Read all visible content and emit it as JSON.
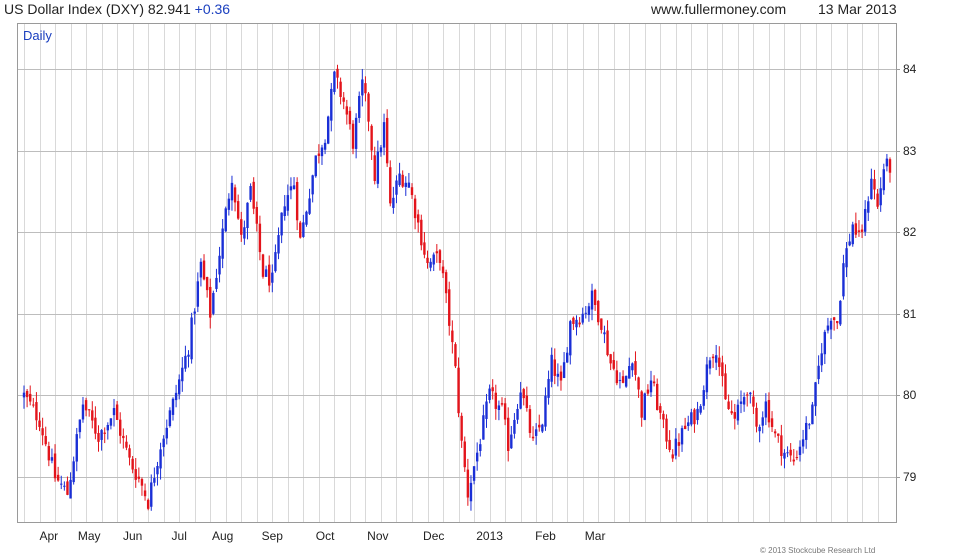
{
  "header": {
    "title": "US Dollar Index (DXY) 82.941",
    "change": "+0.36",
    "site": "www.fullermoney.com",
    "date": "13 Mar 2013"
  },
  "footer": {
    "copyright": "© 2013 Stockcube Research Ltd"
  },
  "colors": {
    "up": "#1a2fd6",
    "down": "#e3141b",
    "grid": "#d9d9d9",
    "frame": "#9a9a9a"
  },
  "chart_data": {
    "type": "candlestick",
    "period_label": "Daily",
    "title": "US Dollar Index (DXY) 82.941 +0.36",
    "y_ticks": [
      79,
      80,
      81,
      82,
      83,
      84
    ],
    "ylim": [
      78.45,
      84.55
    ],
    "x_tick_labels": [
      "Apr",
      "May",
      "Jun",
      "Jul",
      "Aug",
      "Sep",
      "Oct",
      "Nov",
      "Dec",
      "2013",
      "Feb",
      "Mar"
    ],
    "grid": true,
    "close_path": [
      [
        0,
        80.0
      ],
      [
        5,
        79.7
      ],
      [
        10,
        79.0
      ],
      [
        14,
        78.8
      ],
      [
        19,
        79.9
      ],
      [
        24,
        79.5
      ],
      [
        29,
        79.8
      ],
      [
        34,
        79.2
      ],
      [
        38,
        78.9
      ],
      [
        40,
        78.7
      ],
      [
        44,
        79.4
      ],
      [
        48,
        79.9
      ],
      [
        53,
        80.6
      ],
      [
        57,
        81.6
      ],
      [
        60,
        81.0
      ],
      [
        64,
        82.0
      ],
      [
        67,
        82.7
      ],
      [
        70,
        81.9
      ],
      [
        73,
        82.5
      ],
      [
        77,
        81.5
      ],
      [
        80,
        81.4
      ],
      [
        84,
        82.4
      ],
      [
        87,
        82.6
      ],
      [
        89,
        81.9
      ],
      [
        94,
        82.9
      ],
      [
        97,
        83.2
      ],
      [
        100,
        83.9
      ],
      [
        103,
        83.6
      ],
      [
        106,
        83.1
      ],
      [
        109,
        83.8
      ],
      [
        111,
        83.4
      ],
      [
        113,
        82.7
      ],
      [
        116,
        83.3
      ],
      [
        118,
        82.3
      ],
      [
        121,
        82.7
      ],
      [
        124,
        82.6
      ],
      [
        127,
        82.1
      ],
      [
        130,
        81.6
      ],
      [
        134,
        81.7
      ],
      [
        137,
        80.9
      ],
      [
        139,
        80.3
      ],
      [
        141,
        79.4
      ],
      [
        143,
        78.8
      ],
      [
        146,
        79.3
      ],
      [
        150,
        80.0
      ],
      [
        154,
        79.8
      ],
      [
        156,
        79.4
      ],
      [
        160,
        80.1
      ],
      [
        164,
        79.4
      ],
      [
        167,
        79.7
      ],
      [
        170,
        80.4
      ],
      [
        173,
        80.1
      ],
      [
        176,
        80.9
      ],
      [
        180,
        81.0
      ],
      [
        183,
        81.2
      ],
      [
        186,
        80.9
      ],
      [
        189,
        80.4
      ],
      [
        193,
        80.1
      ],
      [
        196,
        80.5
      ],
      [
        199,
        79.8
      ],
      [
        202,
        80.2
      ],
      [
        206,
        79.6
      ],
      [
        209,
        79.3
      ],
      [
        213,
        79.6
      ],
      [
        217,
        79.8
      ],
      [
        221,
        80.5
      ],
      [
        223,
        80.6
      ],
      [
        226,
        79.9
      ],
      [
        229,
        79.7
      ],
      [
        233,
        80.1
      ],
      [
        236,
        79.6
      ],
      [
        239,
        79.9
      ],
      [
        242,
        79.5
      ],
      [
        245,
        79.3
      ],
      [
        248,
        79.2
      ],
      [
        251,
        79.5
      ],
      [
        254,
        79.8
      ],
      [
        257,
        80.6
      ],
      [
        260,
        81.0
      ],
      [
        262,
        80.9
      ],
      [
        264,
        81.6
      ],
      [
        267,
        82.1
      ],
      [
        269,
        81.9
      ],
      [
        271,
        82.2
      ],
      [
        273,
        82.7
      ],
      [
        275,
        82.3
      ],
      [
        277,
        82.8
      ]
    ],
    "x_tick_positions": [
      8,
      21,
      35,
      50,
      64,
      80,
      97,
      114,
      132,
      150,
      168,
      184
    ]
  }
}
